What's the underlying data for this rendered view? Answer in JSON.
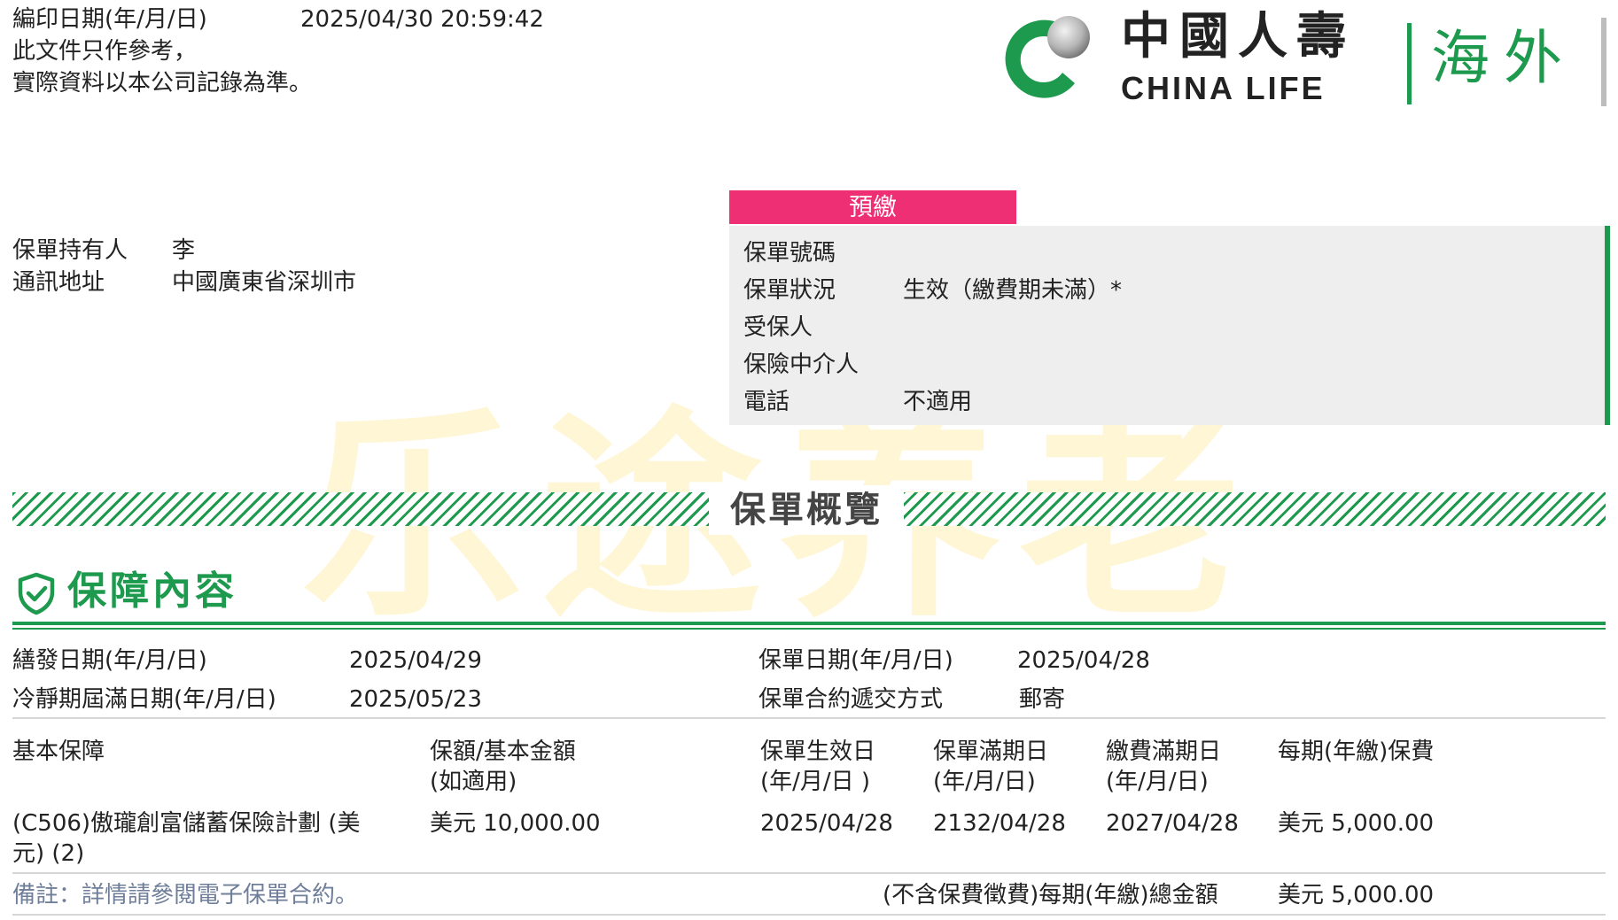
{
  "print_info": {
    "date_label": "編印日期(年/月/日)",
    "date_value": "2025/04/30 20:59:42",
    "notice_line1": "此文件只作參考，",
    "notice_line2": "實際資料以本公司記錄為準。"
  },
  "logo": {
    "name_zh": "中國人壽",
    "name_en": "CHINA LIFE",
    "region": "海外",
    "colors": {
      "green": "#1d9a4d",
      "gray": "#a8a8a8"
    }
  },
  "watermark": "乐途养老",
  "holder": {
    "holder_label": "保單持有人",
    "holder_value": "李",
    "address_label": "通訊地址",
    "address_value": "中國廣東省深圳市"
  },
  "status_panel": {
    "badge": "預繳",
    "badge_color": "#ef2f73",
    "rows": [
      {
        "label": "保單號碼",
        "value": ""
      },
      {
        "label": "保單狀況",
        "value": "生效（繳費期未滿）*"
      },
      {
        "label": "受保人",
        "value": ""
      },
      {
        "label": "保險中介人",
        "value": ""
      },
      {
        "label": "電話",
        "value": "不適用"
      }
    ]
  },
  "overview_title": "保單概覽",
  "coverage": {
    "title": "保障內容",
    "icon": "shield-check-icon",
    "issue_date_label": "繕發日期(年/月/日)",
    "issue_date": "2025/04/29",
    "cooling_label": "冷靜期屆滿日期(年/月/日)",
    "cooling_date": "2025/05/23",
    "policy_date_label": "保單日期(年/月/日)",
    "policy_date": "2025/04/28",
    "delivery_label": "保單合約遞交方式",
    "delivery_value": "郵寄"
  },
  "table": {
    "headers": {
      "basic": "基本保障",
      "sum_line1": "保額/基本金額",
      "sum_line2": "(如適用)",
      "effective_line1": "保單生效日",
      "effective_line2": "(年/月/日 )",
      "maturity_line1": "保單滿期日",
      "maturity_line2": "(年/月/日)",
      "payend_line1": "繳費滿期日",
      "payend_line2": "(年/月/日)",
      "premium": "每期(年繳)保費"
    },
    "row": {
      "plan_line1": "(C506)傲瓏創富儲蓄保險計劃 (美",
      "plan_line2": "元) (2)",
      "sum": "美元 10,000.00",
      "effective": "2025/04/28",
      "maturity": "2132/04/28",
      "payend": "2027/04/28",
      "premium": "美元 5,000.00"
    },
    "remark": "備註：詳情請參閱電子保單合約。",
    "total_label": "(不含保費徵費)每期(年繳)總金額",
    "total_value": "美元 5,000.00"
  }
}
